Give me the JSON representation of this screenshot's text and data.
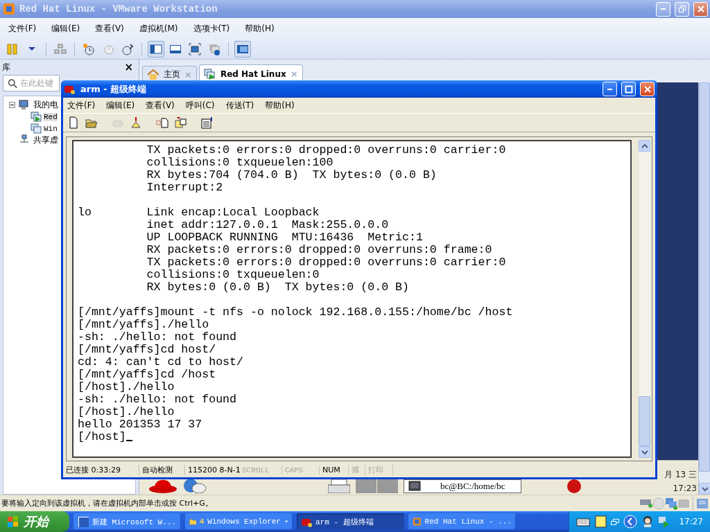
{
  "window": {
    "title": "Red Hat Linux - VMware Workstation"
  },
  "menu": [
    "文件(F)",
    "编辑(E)",
    "查看(V)",
    "虚拟机(M)",
    "选项卡(T)",
    "帮助(H)"
  ],
  "toolbar": [
    {
      "selected": false
    },
    {
      "selected": false
    },
    {
      "selected": false
    },
    {
      "selected": false
    },
    {
      "selected": false
    },
    {
      "selected": false
    },
    {
      "selected": true
    },
    {
      "selected": false
    },
    {
      "selected": false
    },
    {
      "selected": false
    },
    {
      "selected": true
    }
  ],
  "library": {
    "title": "库",
    "close": "×",
    "search": {
      "placeholder": "在此处键"
    },
    "tree": [
      {
        "label": "我的电",
        "expanded": true,
        "children": [
          {
            "label": "Red",
            "selected": true
          },
          {
            "label": "Win",
            "selected": false
          }
        ]
      },
      {
        "label": "共享虚"
      }
    ]
  },
  "tabs": [
    {
      "label": "主页",
      "selected": false,
      "close": "×"
    },
    {
      "label": "Red Hat Linux",
      "selected": true,
      "close": "×"
    }
  ],
  "guest_panel": {
    "task": "bc@BC:/home/bc",
    "date": "月 13 三",
    "time": "17:23"
  },
  "terminal": {
    "title": "arm - 超级终端",
    "menu": [
      "文件(F)",
      "编辑(E)",
      "查看(V)",
      "呼叫(C)",
      "传送(T)",
      "帮助(H)"
    ],
    "toolbar": [
      {
        "disabled": false
      },
      {
        "disabled": false
      },
      {
        "disabled": true
      },
      {
        "disabled": false
      },
      {
        "disabled": false
      },
      {
        "disabled": false
      },
      {
        "disabled": false
      }
    ],
    "console": [
      [
        "          TX packets:0 errors:0 dropped:0 overruns:0 carrier:0",
        "          collisions:0 txqueuelen:100",
        "          RX bytes:704 (704.0 B)  TX bytes:0 (0.0 B)",
        "          Interrupt:2"
      ],
      [
        "lo        Link encap:Local Loopback",
        "          inet addr:127.0.0.1  Mask:255.0.0.0",
        "          UP LOOPBACK RUNNING  MTU:16436  Metric:1",
        "          RX packets:0 errors:0 dropped:0 overruns:0 frame:0",
        "          TX packets:0 errors:0 dropped:0 overruns:0 carrier:0",
        "          collisions:0 txqueuelen:0",
        "          RX bytes:0 (0.0 B)  TX bytes:0 (0.0 B)"
      ],
      [
        "[/mnt/yaffs]mount -t nfs -o nolock 192.168.0.155:/home/bc /host",
        "[/mnt/yaffs]./hello",
        "-sh: ./hello: not found",
        "[/mnt/yaffs]cd host/",
        "cd: 4: can't cd to host/",
        "[/mnt/yaffs]cd /host",
        "[/host]./hello",
        "-sh: ./hello: not found",
        "[/host]./hello",
        "hello 201353 17 37",
        "[/host]"
      ]
    ],
    "status": [
      {
        "text": "已连接 0:33:29",
        "active": true
      },
      {
        "text": "自动检测",
        "active": true
      },
      {
        "text": "115200 8-N-1",
        "active": true
      },
      {
        "text": "SCROLL",
        "active": false
      },
      {
        "text": "CAPS",
        "active": false
      },
      {
        "text": "NUM",
        "active": true
      },
      {
        "text": "捕",
        "active": false
      },
      {
        "text": "打印",
        "active": false
      }
    ]
  },
  "status_bar": {
    "hint": "要将输入定向到该虚拟机，请在虚拟机内部单击或按 Ctrl+G。"
  },
  "taskbar": {
    "start": "开始",
    "items": [
      {
        "label": "新建 Microsoft W...",
        "selected": false
      },
      {
        "count": "4",
        "label": "Windows Explorer",
        "selected": false
      },
      {
        "label": "arm - 超级终端",
        "selected": true
      },
      {
        "label": "Red Hat Linux - ...",
        "selected": false
      }
    ],
    "clock": "17:27"
  }
}
